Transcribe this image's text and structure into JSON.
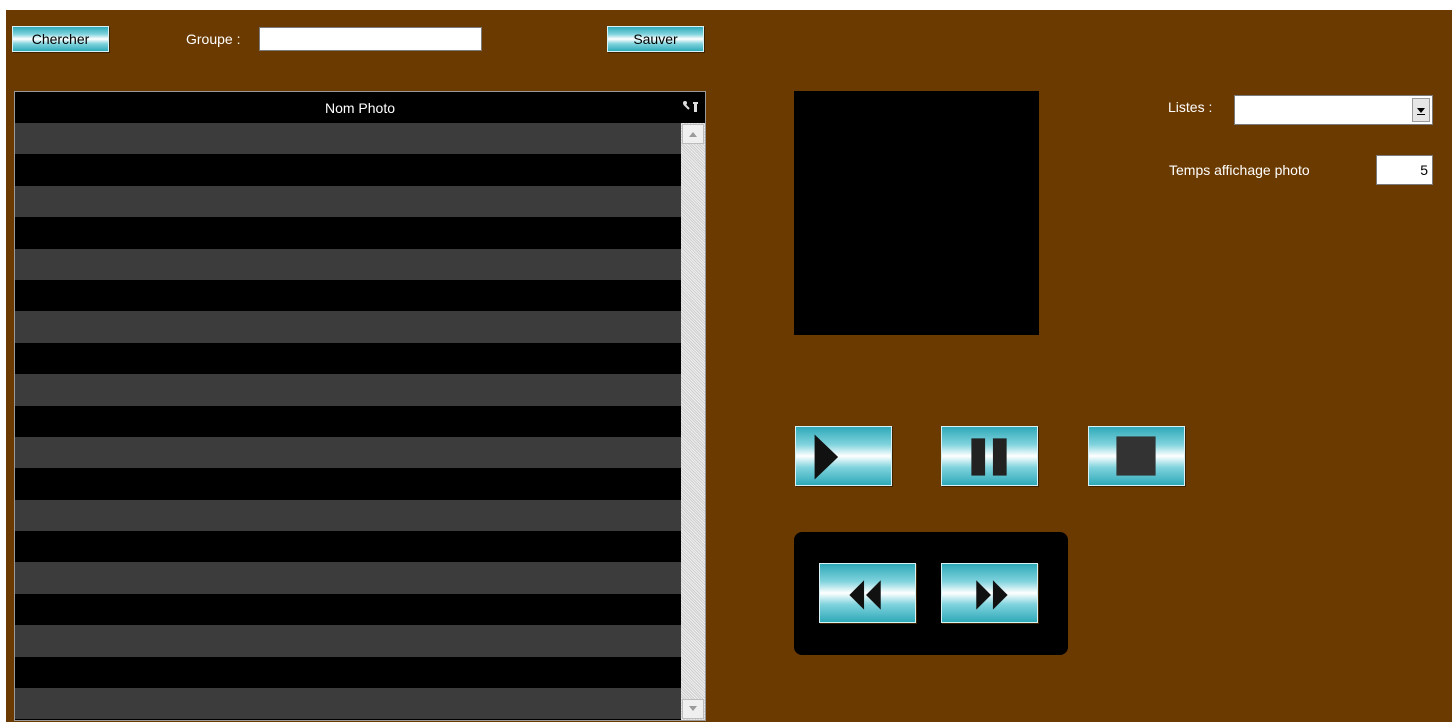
{
  "toolbar": {
    "search_label": "Chercher",
    "group_label": "Groupe :",
    "group_value": "",
    "save_label": "Sauver"
  },
  "table": {
    "column_header": "Nom Photo",
    "rows": []
  },
  "settings": {
    "lists_label": "Listes :",
    "lists_value": "",
    "display_time_label": "Temps affichage photo",
    "display_time_value": "5"
  },
  "controls": {
    "icons": [
      "play-icon",
      "pause-icon",
      "stop-icon",
      "rewind-icon",
      "fast-forward-icon"
    ]
  },
  "colors": {
    "background": "#6b3a00",
    "button_accent": "#2fa9b8",
    "row_alt": "#3c3c3c"
  }
}
